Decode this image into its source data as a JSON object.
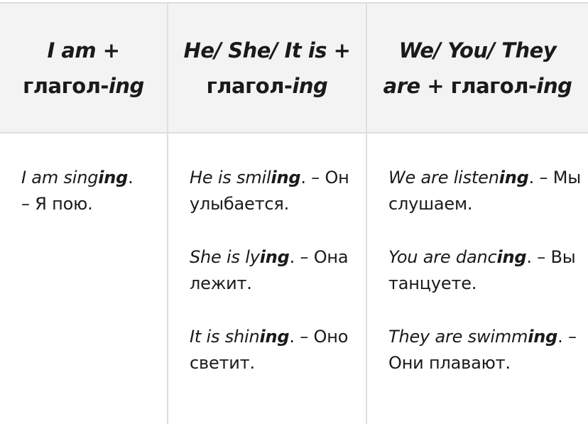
{
  "columns": [
    {
      "header": {
        "line1": "I am +",
        "line2_prefix": "глагол-",
        "line2_suffix": "ing"
      },
      "examples": [
        {
          "stem": "I am sing",
          "suffix": "ing",
          "end": ".",
          "translation": " – Я пою."
        }
      ]
    },
    {
      "header": {
        "line1": "He/ She/ It is +",
        "line2_prefix": "глагол-",
        "line2_suffix": "ing"
      },
      "examples": [
        {
          "stem": "He is smil",
          "suffix": "ing",
          "end": ".",
          "translation": " – Он улыбается."
        },
        {
          "stem": "She is ly",
          "suffix": "ing",
          "end": ".",
          "translation": " – Она лежит."
        },
        {
          "stem": "It is shin",
          "suffix": "ing",
          "end": ".",
          "translation": " – Оно светит."
        }
      ]
    },
    {
      "header": {
        "line1": "We/ You/ They",
        "line2_italic": "are",
        "line2_prefix": " + глагол-",
        "line2_suffix": "ing"
      },
      "examples": [
        {
          "stem": "We are listen",
          "suffix": "ing",
          "end": ".",
          "translation": " – Мы слушаем."
        },
        {
          "stem": "You are danc",
          "suffix": "ing",
          "end": ".",
          "translation": " – Вы танцуете."
        },
        {
          "stem": "They are swimm",
          "suffix": "ing",
          "end": ".",
          "translation": " – Они плавают."
        }
      ]
    }
  ]
}
